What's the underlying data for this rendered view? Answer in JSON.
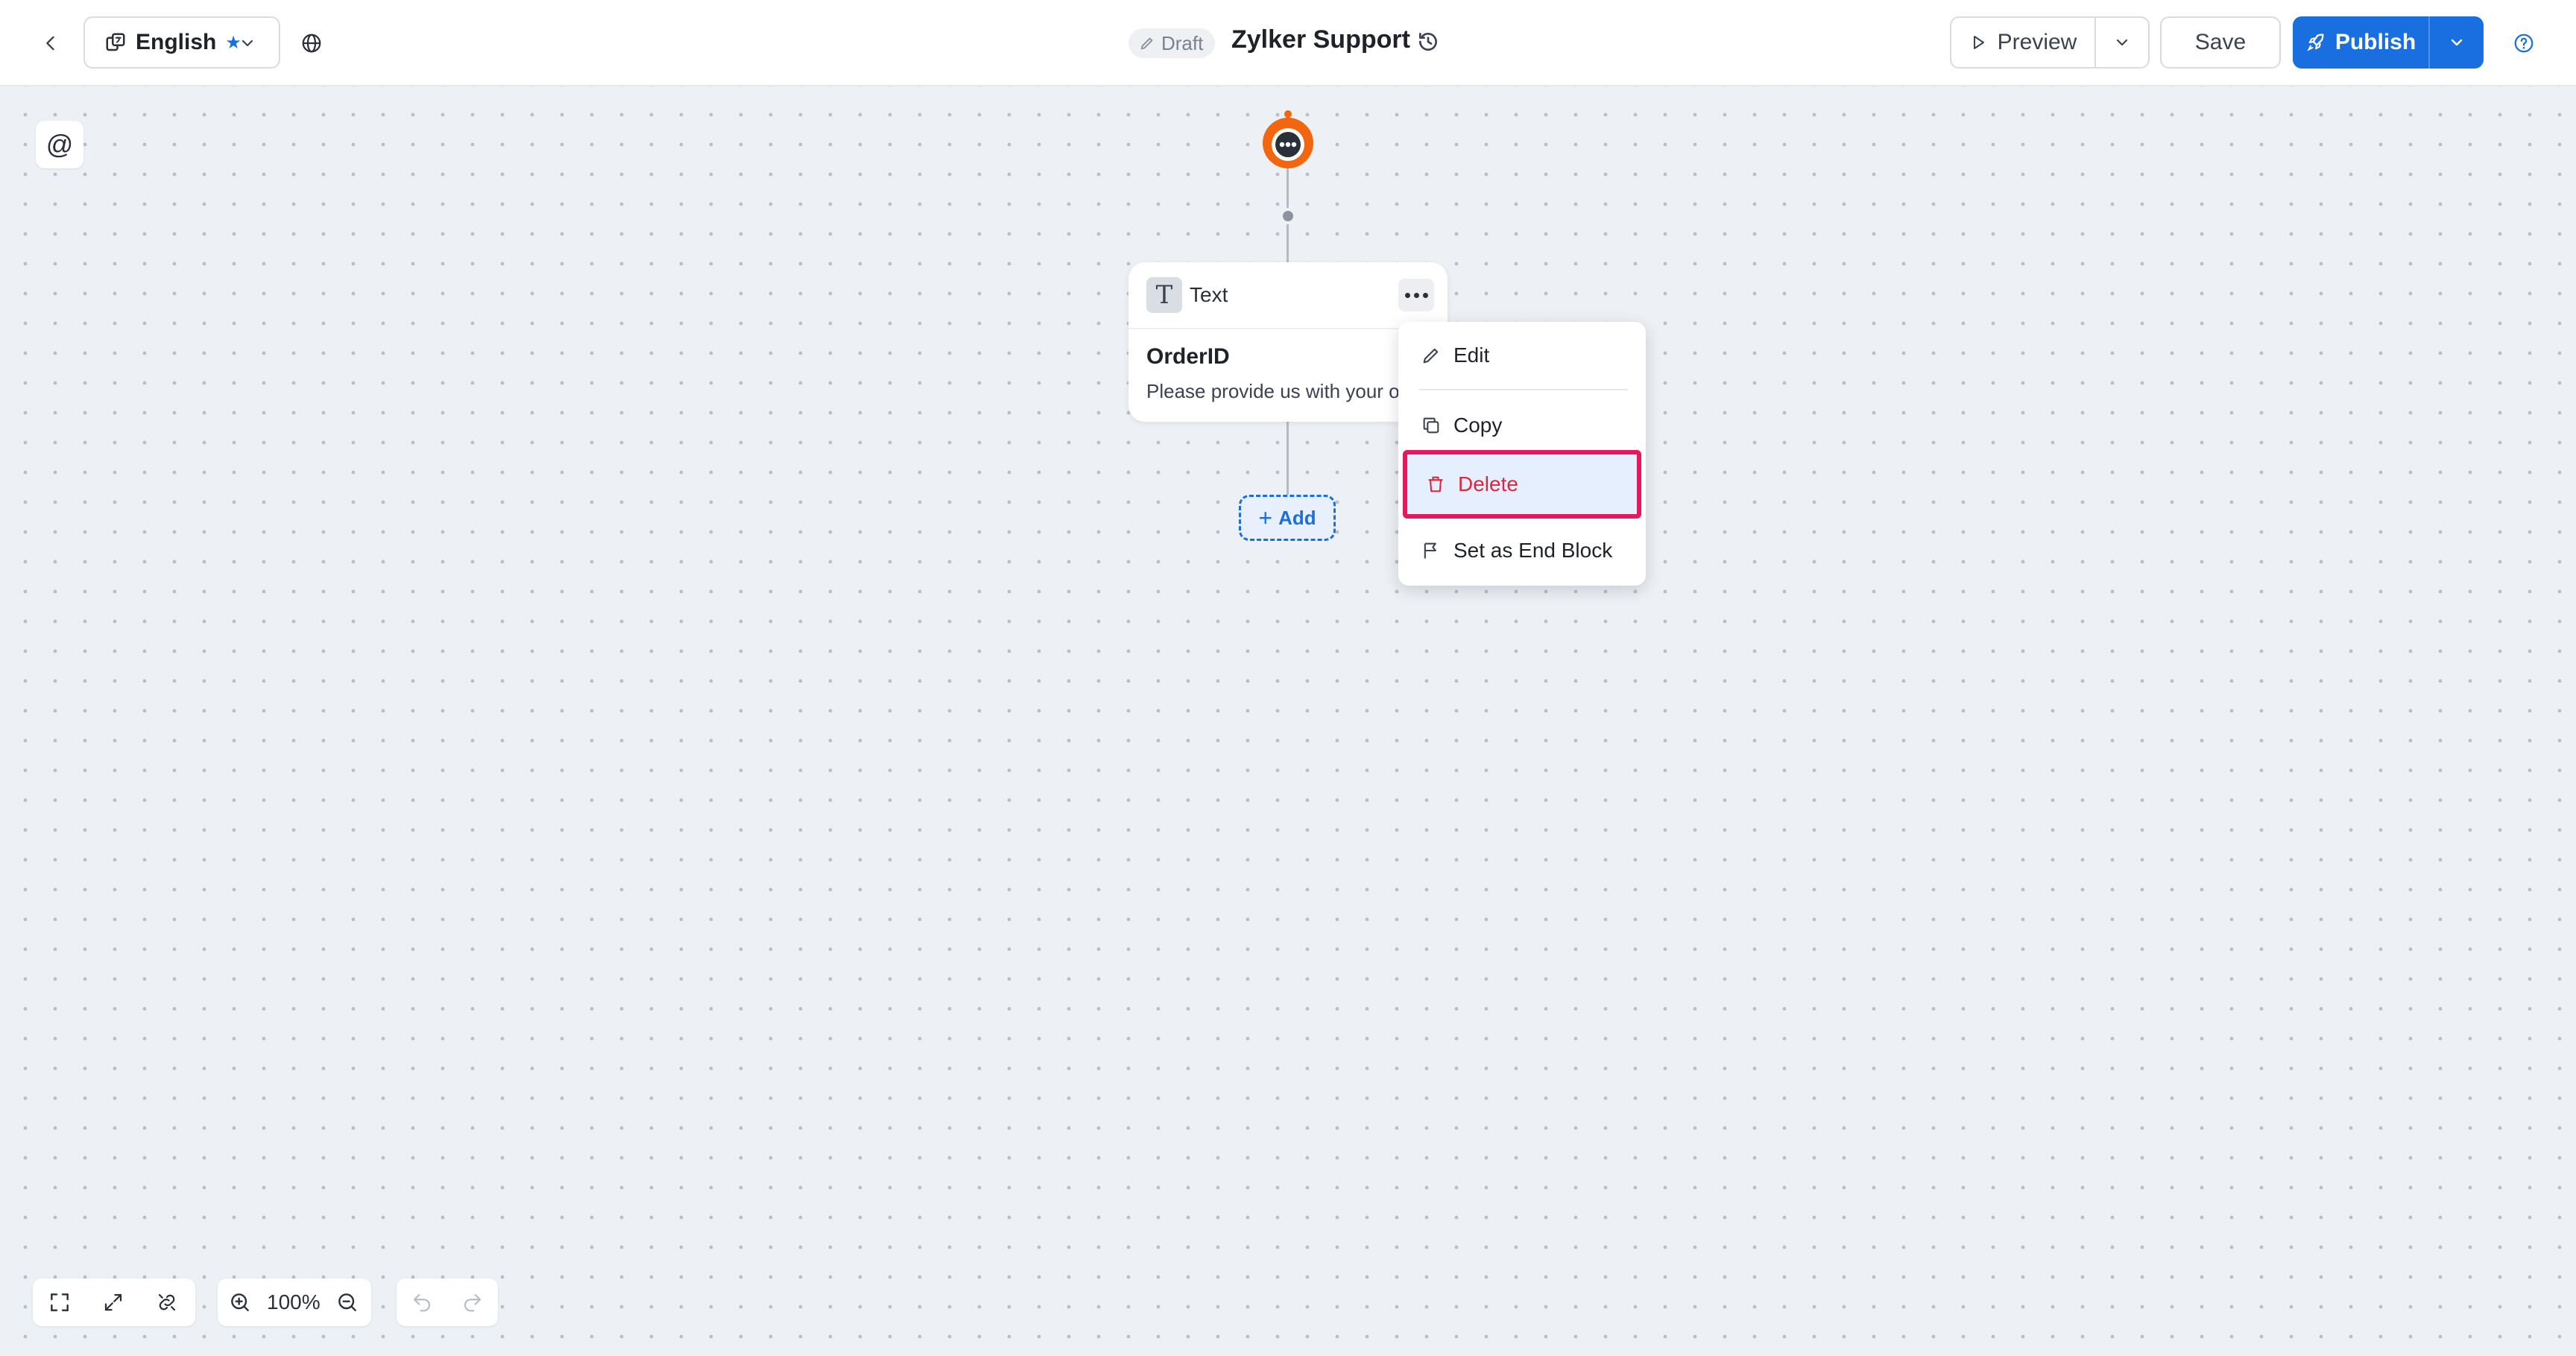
{
  "header": {
    "language": {
      "label": "English",
      "star_icon": "star-icon"
    },
    "status_badge": "Draft",
    "bot_title": "Zylker Support",
    "preview_label": "Preview",
    "save_label": "Save",
    "publish_label": "Publish"
  },
  "canvas": {
    "mention_symbol": "@",
    "text_card": {
      "type_label": "Text",
      "type_icon_glyph": "T",
      "name": "OrderID",
      "message": "Please provide us with your or"
    },
    "add_label": "Add",
    "context_menu": {
      "items": [
        {
          "label": "Edit",
          "icon": "pencil-icon"
        },
        {
          "label": "Copy",
          "icon": "copy-icon"
        },
        {
          "label": "Delete",
          "icon": "trash-icon",
          "highlighted": true
        },
        {
          "label": "Set as End Block",
          "icon": "flag-icon"
        }
      ]
    }
  },
  "toolbar": {
    "zoom_level": "100%"
  },
  "colors": {
    "accent": "#1a6fe0",
    "bot_orange": "#f2660f",
    "delete_red": "#e0263c",
    "highlight_border": "#e8175d",
    "canvas_bg": "#edf0f4"
  }
}
